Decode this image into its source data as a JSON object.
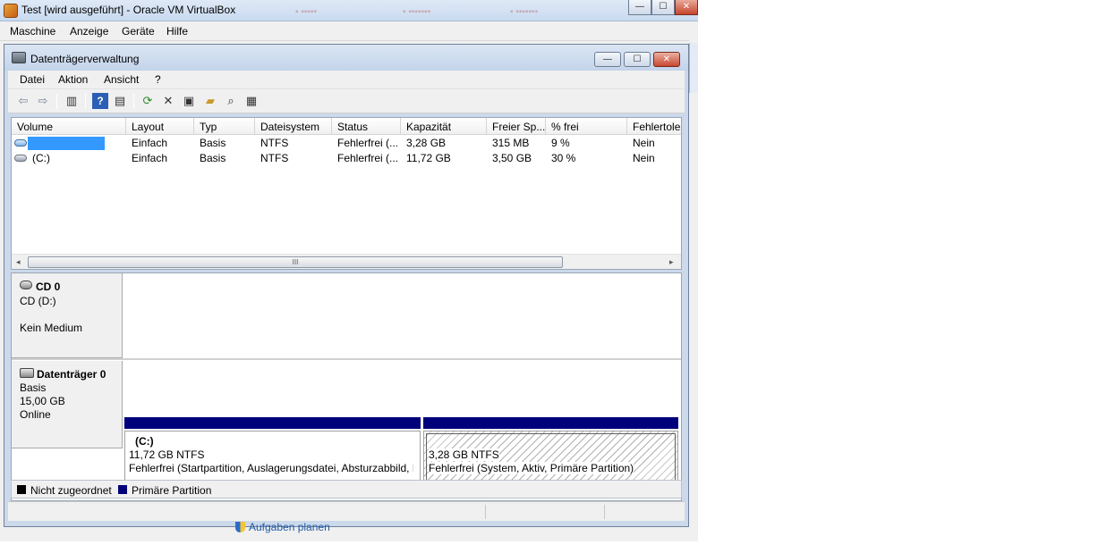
{
  "vbox": {
    "title": "Test [wird ausgeführt] - Oracle VM VirtualBox",
    "menu": [
      "Maschine",
      "Anzeige",
      "Geräte",
      "Hilfe"
    ],
    "min_glyph": "—",
    "max_glyph": "☐",
    "close_glyph": "✕"
  },
  "dm": {
    "title": "Datenträgerverwaltung",
    "menu": [
      "Datei",
      "Aktion",
      "Ansicht",
      "?"
    ],
    "min_glyph": "—",
    "max_glyph": "☐",
    "close_glyph": "✕"
  },
  "toolbar": {
    "icons": [
      "back-arrow-icon",
      "forward-arrow-icon",
      "show-hide-console-tree-icon",
      "help-icon",
      "console-view-icon",
      "refresh-icon",
      "delete-icon",
      "properties-icon",
      "open-folder-icon",
      "find-icon",
      "disk-settings-icon"
    ],
    "glyphs": [
      "⇦",
      "⇨",
      "▥",
      "?",
      "▤",
      "⟳",
      "✕",
      "▣",
      "▰",
      "⌕",
      "▦"
    ]
  },
  "volumes": {
    "columns": [
      "Volume",
      "Layout",
      "Typ",
      "Dateisystem",
      "Status",
      "Kapazität",
      "Freier Sp...",
      "% frei",
      "Fehlertole"
    ],
    "rows": [
      {
        "volume": "",
        "layout": "Einfach",
        "typ": "Basis",
        "fs": "NTFS",
        "status": "Fehlerfrei (...",
        "capacity": "3,28 GB",
        "free": "315 MB",
        "pct": "9 %",
        "fault": "Nein"
      },
      {
        "volume": "(C:)",
        "layout": "Einfach",
        "typ": "Basis",
        "fs": "NTFS",
        "status": "Fehlerfrei (...",
        "capacity": "11,72 GB",
        "free": "3,50 GB",
        "pct": "30 %",
        "fault": "Nein"
      }
    ],
    "scroll_left": "◂",
    "scroll_right": "▸",
    "scroll_grip": "III"
  },
  "disks": {
    "cd": {
      "name": "CD 0",
      "line2": "CD (D:)",
      "line3": "Kein Medium"
    },
    "disk0": {
      "name": "Datenträger 0",
      "type": "Basis",
      "size": "15,00 GB",
      "state": "Online",
      "partitions": [
        {
          "label": "(C:)",
          "size": "11,72 GB NTFS",
          "status": "Fehlerfrei (Startpartition, Auslagerungsdatei, Absturzabbild, P"
        },
        {
          "label": "",
          "size": "3,28 GB NTFS",
          "status": "Fehlerfrei (System, Aktiv, Primäre Partition)"
        }
      ]
    }
  },
  "legend": [
    {
      "label": "Nicht zugeordnet",
      "color": "#000000"
    },
    {
      "label": "Primäre Partition",
      "color": "#00007b"
    }
  ],
  "behind": {
    "link": "Aufgaben planen"
  }
}
